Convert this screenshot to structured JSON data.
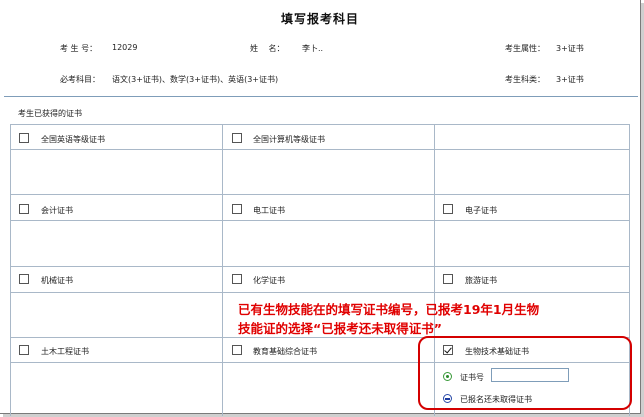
{
  "page": {
    "title": "填写报考科目"
  },
  "student": {
    "exam_no_label": "考 生 号：",
    "exam_no_value": "12029",
    "name_label": "姓　 名：",
    "name_value": "李卜..",
    "attr_label": "考生属性：",
    "attr_value": "3+证书",
    "subjects_label": "必考科目：",
    "subjects_value": "语文(3+证书)、数学(3+证书)、英语(3+证书)",
    "category_label": "考生科类：",
    "category_value": "3+证书"
  },
  "certificates": {
    "section_label": "考生已获得的证书",
    "items": [
      {
        "label": "全国英语等级证书",
        "checked": false
      },
      {
        "label": "全国计算机等级证书",
        "checked": false
      },
      {
        "label": "会计证书",
        "checked": false
      },
      {
        "label": "电工证书",
        "checked": false
      },
      {
        "label": "电子证书",
        "checked": false
      },
      {
        "label": "机械证书",
        "checked": false
      },
      {
        "label": "化学证书",
        "checked": false
      },
      {
        "label": "旅游证书",
        "checked": false
      },
      {
        "label": "土木工程证书",
        "checked": false
      },
      {
        "label": "教育基础综合证书",
        "checked": false
      },
      {
        "label": "生物技术基础证书",
        "checked": true
      }
    ],
    "options": {
      "cert_no_label": "证书号",
      "cert_no_value": "",
      "not_obtained_label": "已报名还未取得证书"
    }
  },
  "annotation": {
    "line1": "已有生物技能在的填写证书编号，已报考19年1月生物",
    "line2": "技能证的选择“已报考还未取得证书”"
  },
  "colors": {
    "annotation": "#e00000",
    "grid": "#a9b8c8"
  }
}
